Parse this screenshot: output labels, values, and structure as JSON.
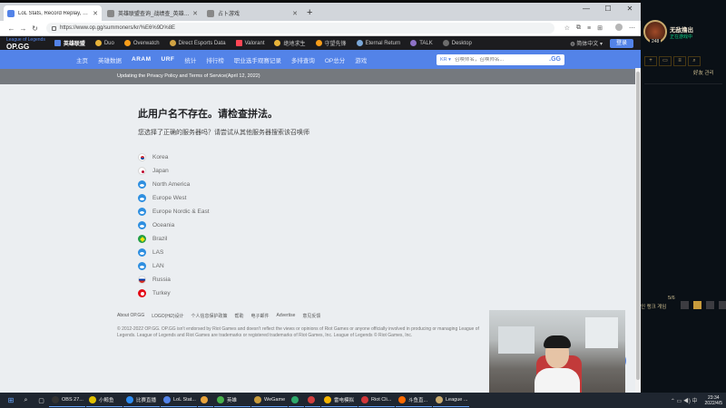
{
  "browser": {
    "tabs": [
      {
        "label": "LoL Stats, Record Replay, Guide",
        "active": true
      },
      {
        "label": "英雄联盟查询_战绩查_英雄联盟",
        "active": false
      },
      {
        "label": "占卜游戏",
        "active": false
      }
    ],
    "url": "https://www.op.gg/summoners/kr/%E6%9D%8E",
    "window_controls": {
      "minimize": "—",
      "maximize": "☐",
      "close": "✕"
    }
  },
  "opgg": {
    "logo": "OP.GG",
    "logo_tag": "League of Legends",
    "games": [
      {
        "label": "英雄联盟",
        "icon": "lol-icon",
        "active": true
      },
      {
        "label": "Duo",
        "icon": "duo-icon",
        "active": false
      },
      {
        "label": "Overwatch",
        "icon": "overwatch-icon",
        "active": false
      },
      {
        "label": "Direct Esports Data",
        "icon": "esports-icon",
        "active": false
      },
      {
        "label": "Valorant",
        "icon": "valorant-icon",
        "active": false
      },
      {
        "label": "绝地求生",
        "icon": "pubg-icon",
        "active": false
      },
      {
        "label": "守望先锋",
        "icon": "overwatch2-icon",
        "active": false
      },
      {
        "label": "Eternal Return",
        "icon": "eternal-return-icon",
        "active": false
      },
      {
        "label": "TALK",
        "icon": "talk-icon",
        "active": false
      },
      {
        "label": "Desktop",
        "icon": "desktop-icon",
        "active": false
      }
    ],
    "language": "简体中文",
    "login_label": "登录",
    "sub_nav": [
      "主页",
      "英雄数据",
      "ARAM",
      "URF",
      "统计",
      "排行榜",
      "职业选手观赛记录",
      "多排查询",
      "OP总分",
      "游戏"
    ],
    "search": {
      "region": "KR",
      "placeholder": "召唤师名，召唤师名...",
      "button": ".GG"
    },
    "notice": "Updating the Privacy Policy and Terms of Service(April 12, 2022)"
  },
  "main": {
    "title": "此用户名不存在。请检查拼法。",
    "subtitle": "您选择了正确的服务器吗？请尝试从其他服务器搜索该召唤师",
    "regions": [
      {
        "label": "Korea",
        "flag": "kr"
      },
      {
        "label": "Japan",
        "flag": "jp"
      },
      {
        "label": "North America",
        "flag": "globe"
      },
      {
        "label": "Europe West",
        "flag": "globe"
      },
      {
        "label": "Europe Nordic & East",
        "flag": "globe"
      },
      {
        "label": "Oceania",
        "flag": "globe"
      },
      {
        "label": "Brazil",
        "flag": "br"
      },
      {
        "label": "LAS",
        "flag": "globe"
      },
      {
        "label": "LAN",
        "flag": "globe"
      },
      {
        "label": "Russia",
        "flag": "ru"
      },
      {
        "label": "Turkey",
        "flag": "tr"
      }
    ]
  },
  "footer": {
    "links": [
      "About OP.GG",
      "LOGO(Hi2)设计",
      "个人信息保护政策",
      "帮助",
      "电子邮件",
      "Advertise",
      "意见反馈"
    ],
    "copyright": "© 2012-2022 OP.GG. OP.GG isn't endorsed by Riot Games and doesn't reflect the views or opinions of Riot Games or anyone officially involved in producing or managing League of Legends. League of Legends and Riot Games are trademarks or registered trademarks of Riot Games, Inc. League of Legends © Riot Games, Inc."
  },
  "sidepanel": {
    "level": "248",
    "name": "无敌撸出",
    "status": "正在游戏中",
    "friends_label": "好友 관리",
    "mini_label": "5/6",
    "rank_text": "인 랭크 게임"
  },
  "taskbar": {
    "apps": [
      {
        "label": "OBS 27...",
        "color": "#333333"
      },
      {
        "label": "小鲸鱼",
        "color": "#e0c000"
      },
      {
        "label": "比赛直播",
        "color": "#2d8cf0"
      },
      {
        "label": "LoL Stat...",
        "color": "#5383e8"
      },
      {
        "label": "",
        "color": "#e8a33c"
      },
      {
        "label": "英雄",
        "color": "#48b04c"
      },
      {
        "label": "WeGame",
        "color": "#c89b3c"
      },
      {
        "label": "",
        "color": "#2ea86b"
      },
      {
        "label": "",
        "color": "#d13f3f"
      },
      {
        "label": "雷电模拟",
        "color": "#f4b400"
      },
      {
        "label": "Riot Cli...",
        "color": "#d13639"
      },
      {
        "label": "斗鱼直...",
        "color": "#ff6a00"
      },
      {
        "label": "League ...",
        "color": "#c8aa6e"
      }
    ],
    "clock_time": "23:34",
    "clock_date": "2022/4/5"
  }
}
